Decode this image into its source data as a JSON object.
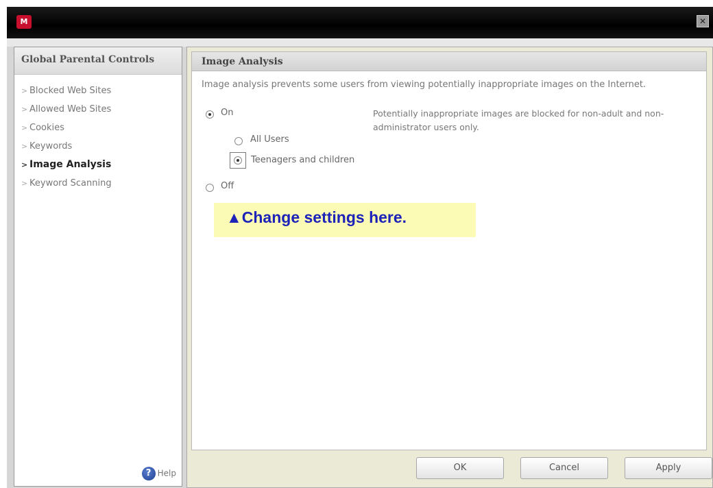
{
  "window": {
    "logo_text": "M",
    "close_glyph": "✕"
  },
  "sidebar": {
    "title": "Global Parental Controls",
    "items": [
      {
        "label": "Blocked Web Sites"
      },
      {
        "label": "Allowed Web Sites"
      },
      {
        "label": "Cookies"
      },
      {
        "label": "Keywords"
      },
      {
        "label": "Image Analysis",
        "active": true
      },
      {
        "label": "Keyword Scanning"
      }
    ],
    "help_label": "Help"
  },
  "panel": {
    "title": "Image Analysis",
    "description": "Image analysis prevents some users from viewing potentially inappropriate images on the Internet.",
    "options": {
      "on_label": "On",
      "on_selected": true,
      "all_users_label": "All Users",
      "all_users_selected": false,
      "teen_label": "Teenagers and children",
      "teen_selected": true,
      "off_label": "Off",
      "off_selected": false
    },
    "note": "Potentially inappropriate images are blocked for non-adult and non-administrator users only.",
    "callout": "▲Change settings here."
  },
  "footer": {
    "ok_label": "OK",
    "cancel_label": "Cancel",
    "apply_label": "Apply"
  },
  "colors": {
    "callout_bg": "#fbfbb6",
    "callout_text": "#1d22b8",
    "brand_red": "#c8102e"
  }
}
